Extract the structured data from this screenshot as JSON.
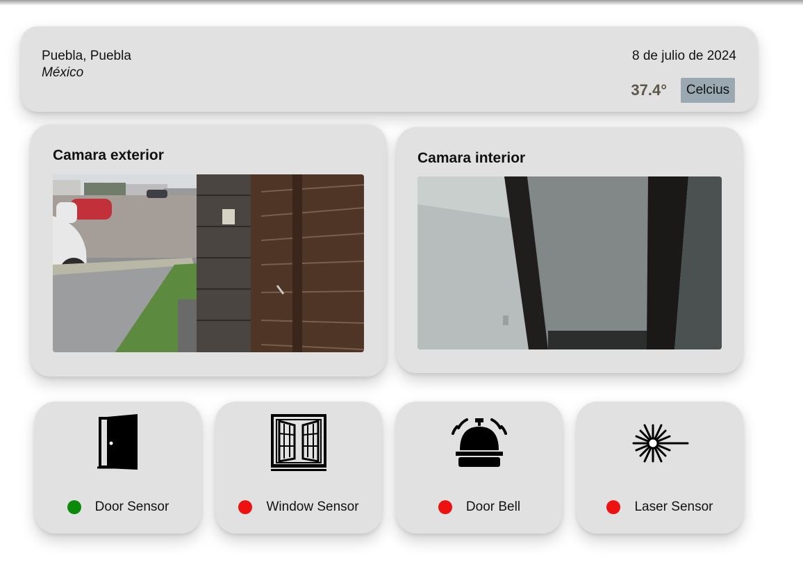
{
  "header": {
    "city": "Puebla, Puebla",
    "country": "México",
    "date": "8 de julio de 2024",
    "temperature": "37.4°",
    "unit_label": "Celcius"
  },
  "cameras": [
    {
      "title": "Camara exterior"
    },
    {
      "title": "Camara interior"
    }
  ],
  "sensors": [
    {
      "label": "Door Sensor",
      "icon": "door-icon",
      "status_color": "#0b8a0b"
    },
    {
      "label": "Window Sensor",
      "icon": "window-icon",
      "status_color": "#ee1111"
    },
    {
      "label": "Door Bell",
      "icon": "bell-icon",
      "status_color": "#ee1111"
    },
    {
      "label": "Laser Sensor",
      "icon": "laser-icon",
      "status_color": "#ee1111"
    }
  ],
  "colors": {
    "card": "#e1e1e1",
    "unit_button": "#9aa8b2",
    "temperature": "#5d574a"
  }
}
